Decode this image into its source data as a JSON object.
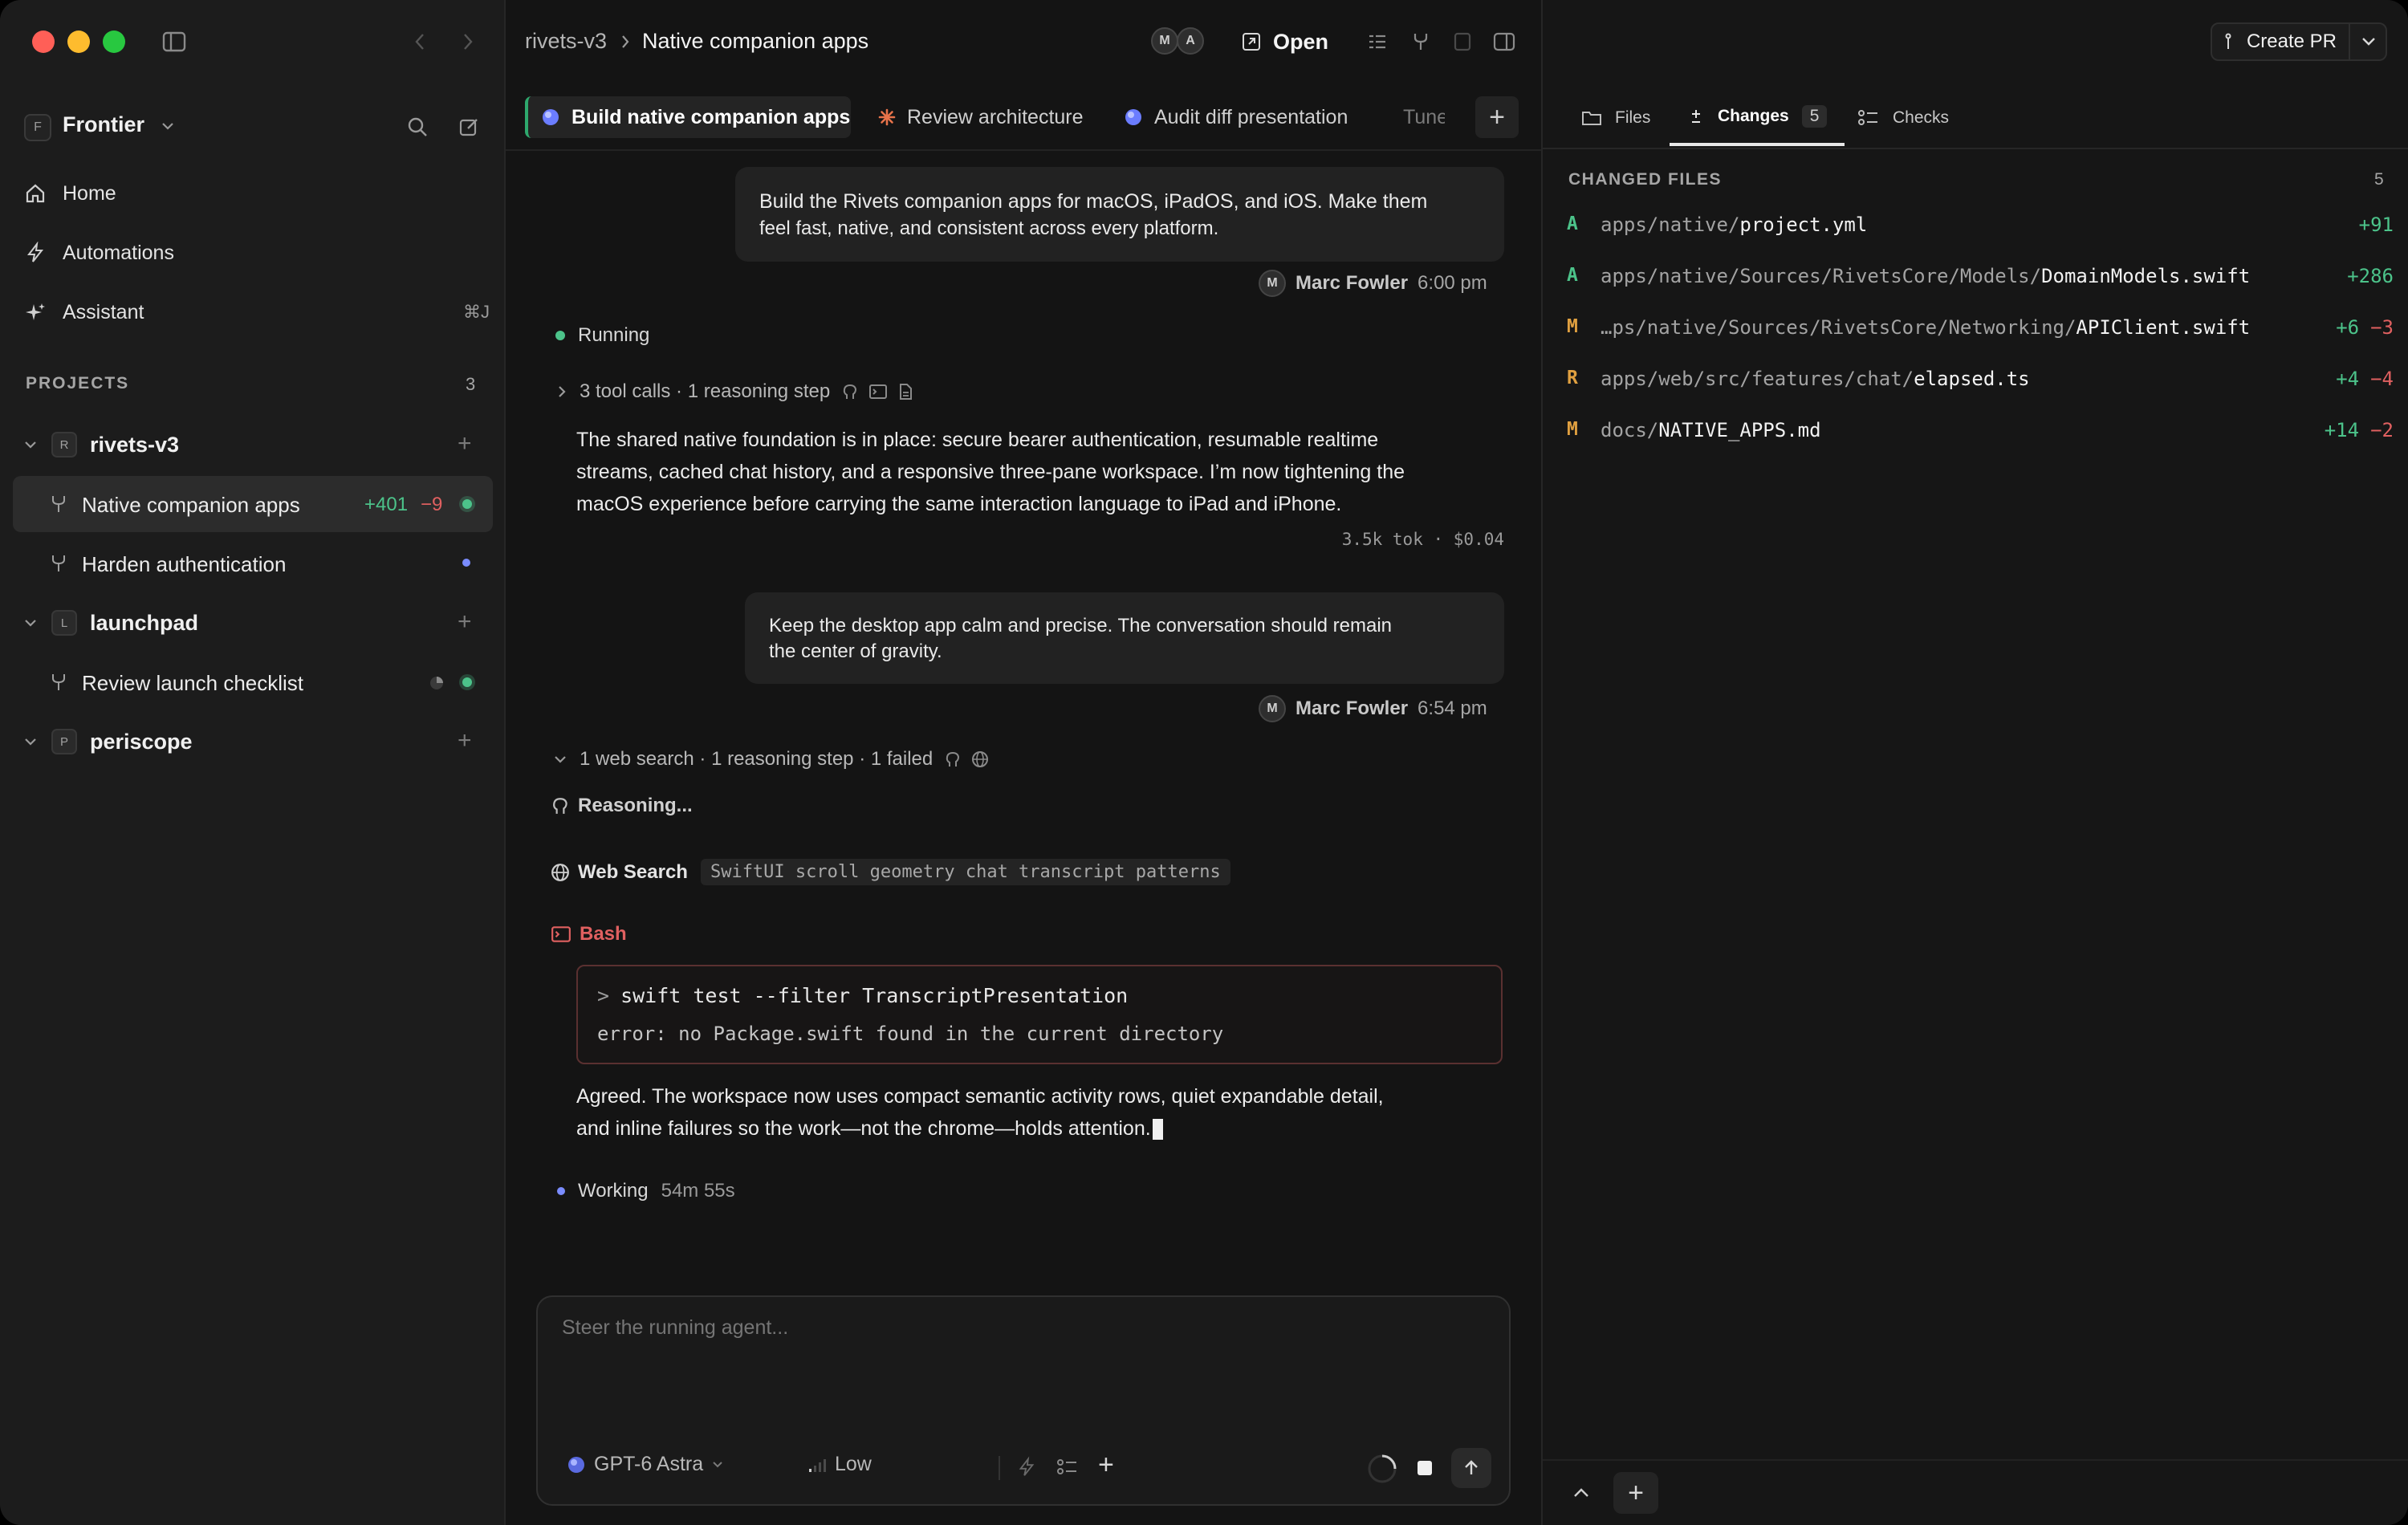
{
  "sidebar": {
    "workspace_badge": "F",
    "workspace_name": "Frontier",
    "nav": [
      {
        "label": "Home",
        "icon": "home-icon"
      },
      {
        "label": "Automations",
        "icon": "bolt-icon"
      },
      {
        "label": "Assistant",
        "icon": "sparkle-icon",
        "shortcut": "⌘J"
      }
    ],
    "projects_title": "PROJECTS",
    "projects_count": "3",
    "projects": [
      {
        "badge": "R",
        "name": "rivets-v3",
        "tasks": [
          {
            "name": "Native companion apps",
            "additions": "+401",
            "deletions": "−9",
            "status": "active"
          },
          {
            "name": "Harden authentication",
            "status": "pending"
          }
        ]
      },
      {
        "badge": "L",
        "name": "launchpad",
        "tasks": [
          {
            "name": "Review launch checklist",
            "status": "active"
          }
        ]
      },
      {
        "badge": "P",
        "name": "periscope",
        "tasks": []
      }
    ]
  },
  "header": {
    "breadcrumb_project": "rivets-v3",
    "breadcrumb_task": "Native companion apps",
    "avatars": [
      "M",
      "A"
    ],
    "open_label": "Open",
    "create_pr_label": "Create PR"
  },
  "tabs": [
    {
      "label": "Build native companion apps",
      "active": true
    },
    {
      "label": "Review architecture"
    },
    {
      "label": "Audit diff presentation"
    },
    {
      "label": "Tune"
    }
  ],
  "conversation": {
    "user_msg_1": {
      "line1": "Build the Rivets companion apps for macOS, iPadOS, and iOS. Make them",
      "line2": "feel fast, native, and consistent across every platform.",
      "author_initial": "M",
      "author": "Marc Fowler",
      "time": "6:00 pm"
    },
    "status_running": "Running",
    "summary_1": "3 tool calls · 1 reasoning step",
    "assistant_msg_1": [
      "The shared native foundation is in place: secure bearer authentication, resumable realtime",
      "streams, cached chat history, and a responsive three-pane workspace. I’m now tightening the",
      "macOS experience before carrying the same interaction language to iPad and iPhone."
    ],
    "usage": "3.5k tok · $0.04",
    "user_msg_2": {
      "line1": "Keep the desktop app calm and precise. The conversation should remain",
      "line2": "the center of gravity.",
      "author_initial": "M",
      "author": "Marc Fowler",
      "time": "6:54 pm"
    },
    "summary_2": "1 web search · 1 reasoning step · 1 failed",
    "reasoning_label": "Reasoning...",
    "web_search_label": "Web Search",
    "web_search_query": "SwiftUI scroll geometry chat transcript patterns",
    "bash_label": "Bash",
    "bash_prompt": ">",
    "bash_command": "swift test --filter TranscriptPresentation",
    "bash_error": "error: no Package.swift found in the current directory",
    "assistant_msg_2": [
      "Agreed. The workspace now uses compact semantic activity rows, quiet expandable detail,",
      "and inline failures so the work—not the chrome—holds attention."
    ],
    "working_label": "Working",
    "working_elapsed": "54m 55s"
  },
  "composer": {
    "placeholder": "Steer the running agent...",
    "model": "GPT-6 Astra",
    "effort": "Low"
  },
  "right_panel": {
    "tabs": [
      {
        "label": "Files"
      },
      {
        "label": "Changes",
        "count": "5",
        "active": true
      },
      {
        "label": "Checks"
      }
    ],
    "changed_title": "CHANGED FILES",
    "changed_count": "5",
    "files": [
      {
        "status": "A",
        "dir": "apps/native/",
        "name": "project.yml",
        "add": "+91",
        "del": ""
      },
      {
        "status": "A",
        "dir": "apps/native/Sources/RivetsCore/Models/",
        "name": "DomainModels.swift",
        "add": "+286",
        "del": ""
      },
      {
        "status": "M",
        "dir": "…ps/native/Sources/RivetsCore/Networking/",
        "name": "APIClient.swift",
        "add": "+6",
        "del": "−3"
      },
      {
        "status": "R",
        "dir": "apps/web/src/features/chat/",
        "name": "elapsed.ts",
        "add": "+4",
        "del": "−4"
      },
      {
        "status": "M",
        "dir": "docs/",
        "name": "NATIVE_APPS.md",
        "add": "+14",
        "del": "−2"
      }
    ]
  },
  "colors": {
    "added": "#4cc38a",
    "deleted": "#e06060",
    "modified": "#e0a040",
    "renamed": "#e0a040",
    "error": "#e06060",
    "running": "#4cc38a",
    "accent_blue": "#7a8cff"
  }
}
